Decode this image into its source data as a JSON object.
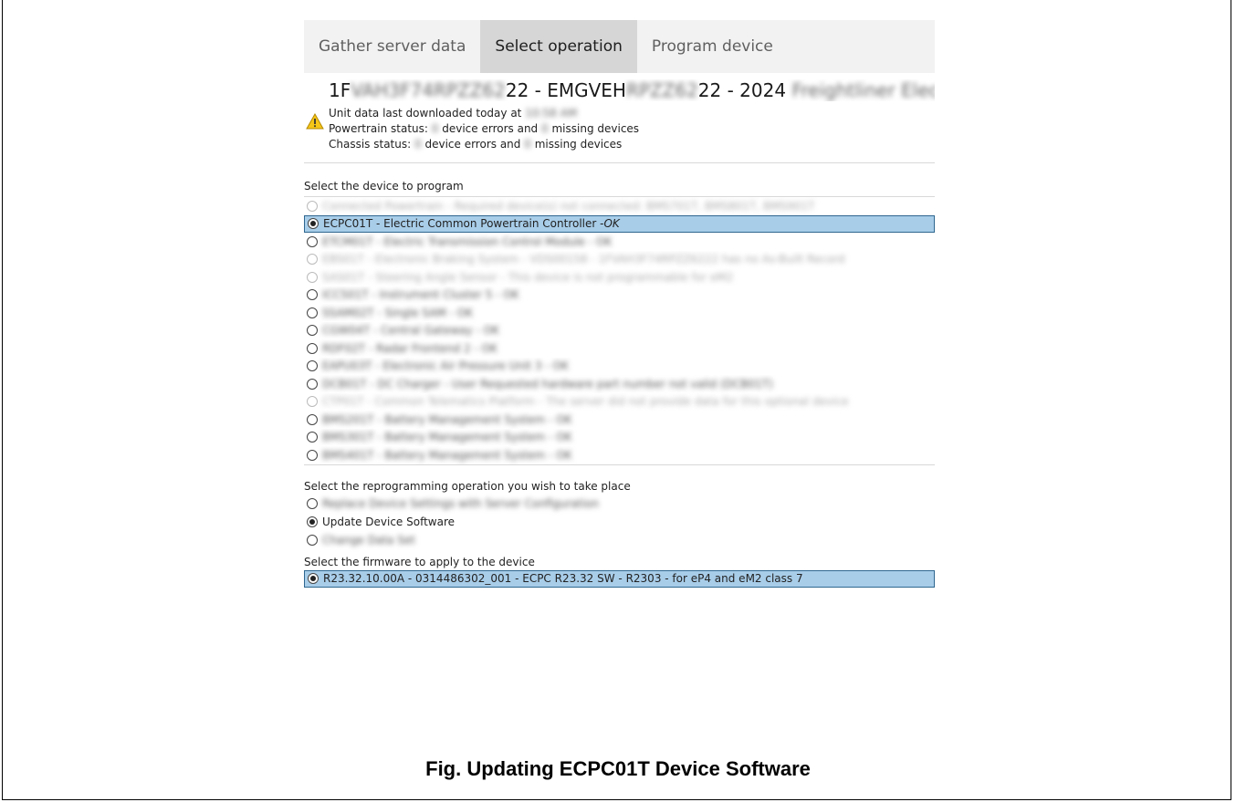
{
  "tabs": [
    {
      "label": "Gather server data"
    },
    {
      "label": "Select operation"
    },
    {
      "label": "Program device"
    }
  ],
  "header": {
    "vin_prefix": "1F",
    "vin_mid_blur": "VAH3F74RPZZ62",
    "vin_tail": "22 - EMGVEH",
    "vin_mid2_blur": "RPZZ62",
    "vin_tail2": "22 - 2024 ",
    "make_blur": "Freightliner Electric",
    "download_prefix": "Unit data last downloaded today at",
    "download_time_blur": "10:58 AM",
    "powertrain_prefix": "Powertrain status:",
    "powertrain_num_blur": "0",
    "powertrain_mid": "device errors and",
    "powertrain_num2_blur": "0",
    "powertrain_suffix": "missing devices",
    "chassis_prefix": "Chassis status:",
    "chassis_num_blur": "0",
    "chassis_mid": "device errors and",
    "chassis_num2_blur": "0",
    "chassis_suffix": "missing devices"
  },
  "device_section": {
    "label": "Select the device to program",
    "devices": [
      {
        "text": "Connected Powertrain - Required device(s) not connected: BMS701T, BMS801T, BMS901T",
        "dim": true
      },
      {
        "text": "ECPC01T - Electric Common Powertrain Controller - ",
        "status": "OK",
        "selected": true
      },
      {
        "text": "ETCM01T - Electric Transmission Control Module - OK"
      },
      {
        "text": "EBS01T - Electronic Braking System - VDS00158 - 1FVAH3F74RPZZ6222 has no As-Built Record",
        "dim": true
      },
      {
        "text": "SAS01T - Steering Angle Sensor - This device is not programmable for eM2",
        "dim": true
      },
      {
        "text": "ICC501T - Instrument Cluster 5 - OK"
      },
      {
        "text": "SSAM02T - Single SAM - OK"
      },
      {
        "text": "CGW04T - Central Gateway - OK"
      },
      {
        "text": "RDF02T - Radar Frontend 2 - OK"
      },
      {
        "text": "EAPU03T - Electronic Air Pressure Unit 3 - OK"
      },
      {
        "text": "DCB01T - DC Charger - User Requested hardware part number not valid (DCB01T)"
      },
      {
        "text": "CTP01T - Common Telematics Platform - The server did not provide data for this optional device",
        "dim": true
      },
      {
        "text": "BMS201T - Battery Management System - OK"
      },
      {
        "text": "BMS301T - Battery Management System - OK"
      },
      {
        "text": "BMS401T - Battery Management System - OK"
      }
    ]
  },
  "operation_section": {
    "label": "Select the reprogramming operation you wish to take place",
    "options": [
      {
        "text": "Replace Device Settings with Server Configuration",
        "blur": true
      },
      {
        "text": "Update Device Software",
        "selected": true
      },
      {
        "text": "Change Data Set",
        "blur": true
      }
    ]
  },
  "firmware_section": {
    "label": "Select the firmware to apply to the device",
    "selected": "R23.32.10.00A - 0314486302_001 - ECPC R23.32 SW - R2303 - for eP4 and eM2 class 7"
  },
  "caption": "Fig. Updating ECPC01T Device Software",
  "colors": {
    "selection": "#a8cde9",
    "selection_border": "#2f6790",
    "active_tab": "#d6d6d6"
  },
  "icons": {
    "warning": "warning-icon"
  }
}
